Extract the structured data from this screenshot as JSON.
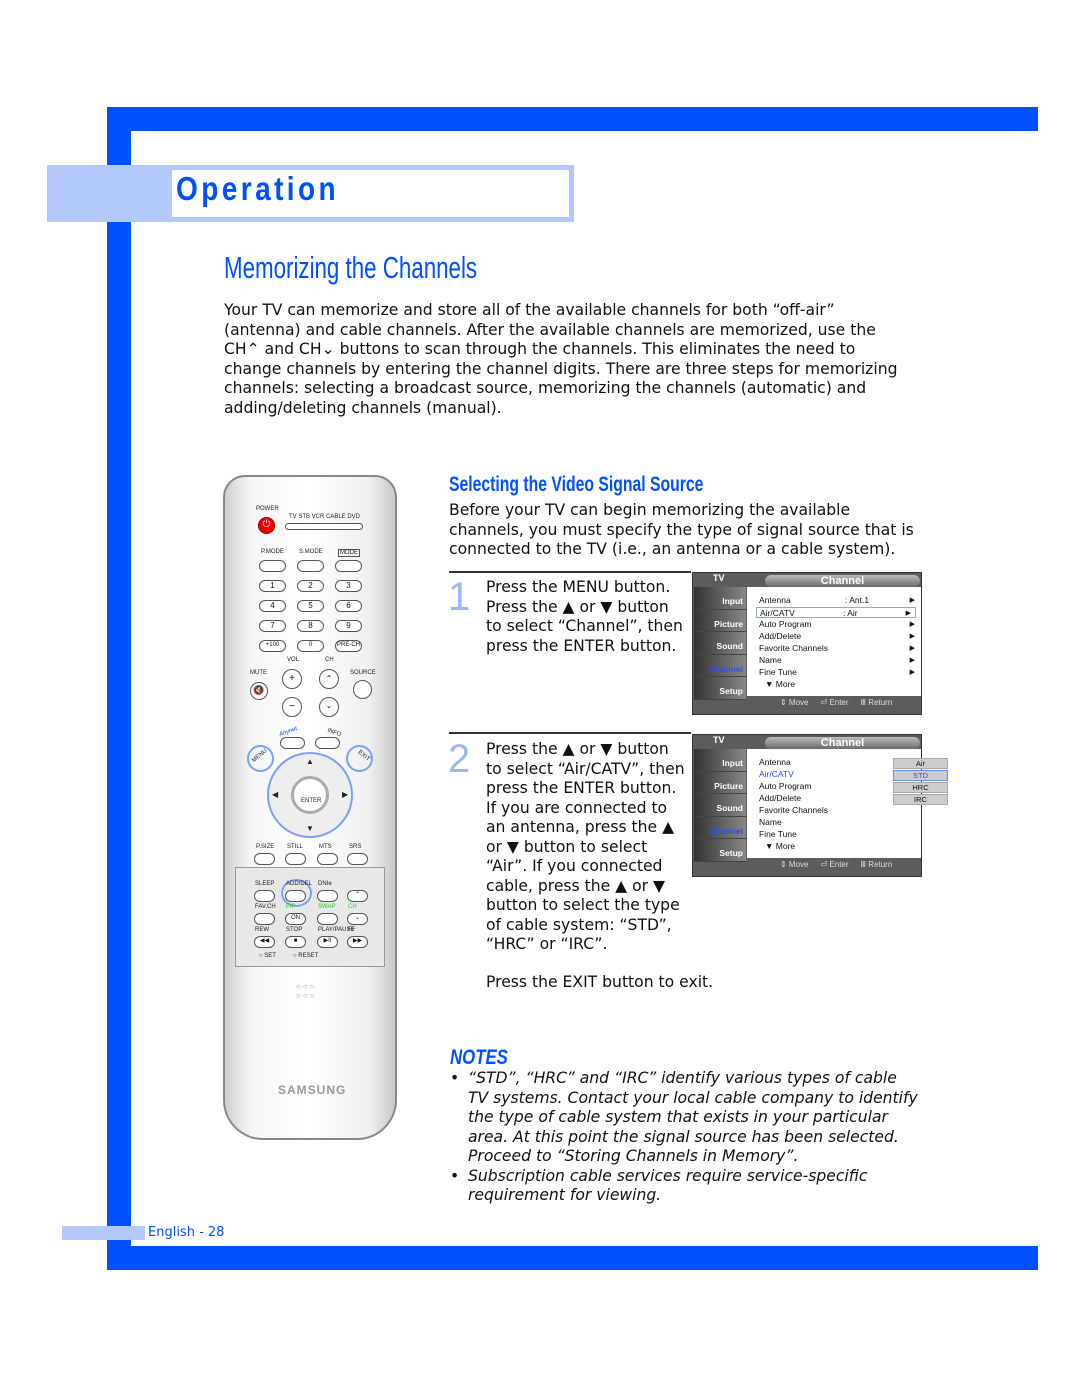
{
  "section": "Operation",
  "title": "Memorizing the Channels",
  "intro": "Your TV can memorize and store all of the available channels for both “off-air” (antenna) and cable channels. After the available channels are memorized, use the CH⌃ and CH⌄ buttons to scan through the channels. This eliminates the need to change channels by entering the channel digits. There are three steps for memorizing channels: selecting a broadcast source, memorizing the channels (automatic) and adding/deleting channels (manual).",
  "subsection": {
    "title": "Selecting the Video Signal Source",
    "body": "Before your TV can begin memorizing the available channels, you must specify the type of signal source that is connected to the TV (i.e., an antenna or a cable system)."
  },
  "steps": [
    {
      "num": "1",
      "text": "Press the MENU button. Press the ▲ or ▼ button to select “Channel”, then press the ENTER button."
    },
    {
      "num": "2",
      "text": "Press the ▲ or ▼ button to select “Air/CATV”, then press the ENTER button. If you are connected to an antenna, press the ▲ or ▼ button to select “Air”. If you connected cable, press the ▲ or ▼ button to select the type of cable system: “STD”, “HRC” or “IRC”.",
      "exit": "Press the EXIT button to exit."
    }
  ],
  "osd": {
    "tv": "TV",
    "title": "Channel",
    "side": [
      "Input",
      "Picture",
      "Sound",
      "Channel",
      "Setup"
    ],
    "items": [
      "Antenna",
      "Air/CATV",
      "Auto Program",
      "Add/Delete",
      "Favorite Channels",
      "Name",
      "Fine Tune",
      "▼ More"
    ],
    "values1": {
      "antenna": ": Ant.1",
      "aircatv": ": Air"
    },
    "options2": [
      "Air",
      "STD",
      "HRC",
      "IRC"
    ],
    "footer": [
      "⇕ Move",
      "⏎ Enter",
      "Ⅲ Return"
    ]
  },
  "notes": {
    "title": "NOTES",
    "items": [
      "“STD”, “HRC” and “IRC” identify various types of cable TV systems. Contact your local cable company to identify the type of cable system that exists in your particular area. At this point the signal source has been selected. Proceed to “Storing Channels in Memory”.",
      "Subscription cable services require service-specific requirement for viewing."
    ]
  },
  "footer": "English - 28",
  "remote": {
    "power": "POWER",
    "modes": "TV  STB  VCR  CABLE  DVD",
    "pmode": "P.MODE",
    "smode": "S.MODE",
    "mode": "MODE",
    "digits": [
      "1",
      "2",
      "3",
      "4",
      "5",
      "6",
      "7",
      "8",
      "9",
      "+100",
      "0",
      "PRE-CH"
    ],
    "vol": "VOL",
    "ch": "CH",
    "mute": "MUTE",
    "source": "SOURCE",
    "anynet": "Anynet",
    "info": "INFO",
    "menu": "MENU",
    "exit": "EXIT",
    "enter": "ENTER",
    "row1": [
      "P.SIZE",
      "STILL",
      "MTS",
      "SRS"
    ],
    "row2": [
      "SLEEP",
      "ADD/DEL",
      "DNIe"
    ],
    "row3": [
      "FAV.CH",
      "PIP",
      "SWAP",
      "CH"
    ],
    "on": "ON",
    "row4": [
      "REW",
      "STOP",
      "PLAY/PAUSE",
      "FF"
    ],
    "set": "SET",
    "reset": "RESET",
    "brand": "SAMSUNG"
  },
  "colors": {
    "brand_blue": "#0050ff",
    "light_blue": "#b3c8fb"
  }
}
